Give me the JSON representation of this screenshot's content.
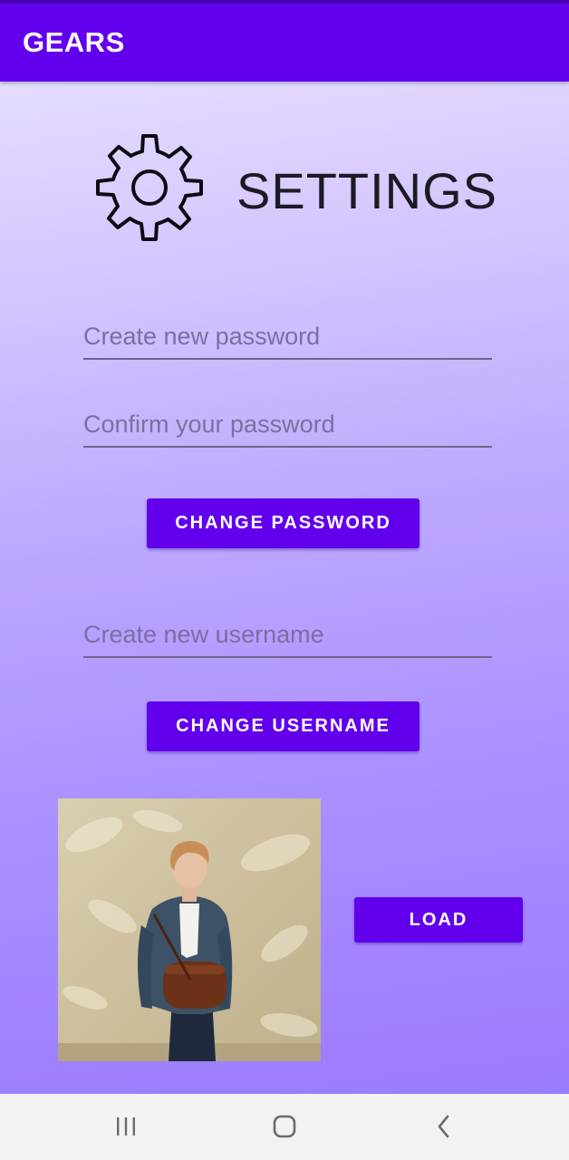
{
  "app_bar": {
    "title": "GEARS"
  },
  "header": {
    "icon": "gear-icon",
    "title": "SETTINGS"
  },
  "password_section": {
    "new_password_placeholder": "Create new password",
    "new_password_value": "",
    "confirm_password_placeholder": "Confirm your password",
    "confirm_password_value": "",
    "button_label": "CHANGE PASSWORD"
  },
  "username_section": {
    "new_username_placeholder": "Create new username",
    "new_username_value": "",
    "button_label": "CHANGE USERNAME"
  },
  "image_section": {
    "load_button_label": "LOAD"
  },
  "nav_bar": {
    "items": [
      "recent-apps-icon",
      "home-icon",
      "back-icon"
    ]
  },
  "colors": {
    "primary": "#6200ee",
    "primary_dark": "#4b00b8",
    "background_top": "#e6dcff",
    "background_bottom": "#9a7bff",
    "field_underline": "#6f6685",
    "nav_bar": "#f2f1f3"
  }
}
